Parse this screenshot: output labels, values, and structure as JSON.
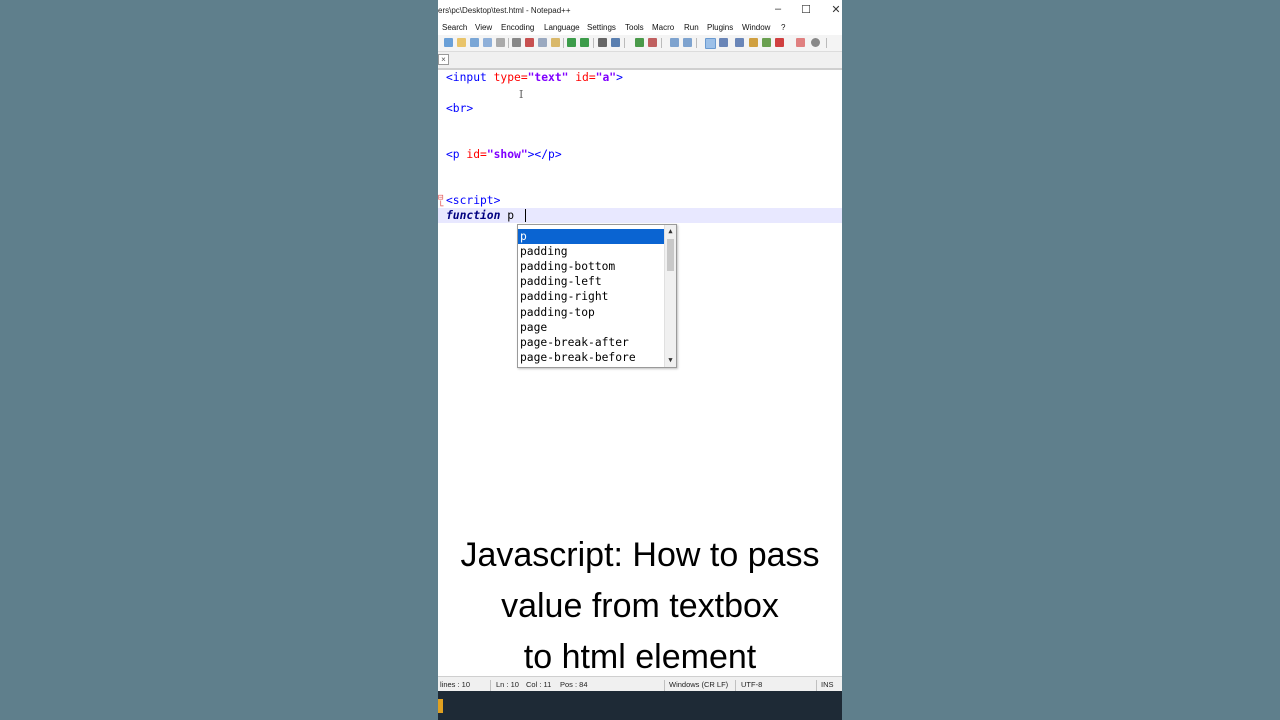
{
  "window": {
    "title": "ers\\pc\\Desktop\\test.html - Notepad++",
    "minimize": "–",
    "maximize": "☐",
    "close": "✕"
  },
  "menu": [
    "Search",
    "View",
    "Encoding",
    "Language",
    "Settings",
    "Tools",
    "Macro",
    "Run",
    "Plugins",
    "Window",
    "?"
  ],
  "editor": {
    "line1": {
      "open": "<input ",
      "attr1": "type=",
      "val1": "\"text\"",
      "attr2": " id=",
      "val2": "\"a\"",
      "close": ">"
    },
    "line3": {
      "tag": "<br>"
    },
    "line6": {
      "open": "<p ",
      "attr": "id=",
      "val": "\"show\"",
      "close": "></p>"
    },
    "line9": {
      "tag": "<script>"
    },
    "line10": {
      "keyword": "function",
      "text": " p"
    }
  },
  "autocomplete": {
    "items": [
      "p",
      "padding",
      "padding-bottom",
      "padding-left",
      "padding-right",
      "padding-top",
      "page",
      "page-break-after",
      "page-break-before"
    ],
    "selected": "p"
  },
  "caption": {
    "line1": "Javascript: How to pass",
    "line2": "value from textbox",
    "line3": "to html element"
  },
  "status": {
    "lines": "lines : 10",
    "ln": "Ln : 10",
    "col": "Col : 11",
    "pos": "Pos : 84",
    "eol": "Windows (CR LF)",
    "encoding": "UTF-8",
    "mode": "INS"
  },
  "colors": {
    "background": "#5f7f8c",
    "tag": "#0000ff",
    "attribute": "#ff0000",
    "string": "#8000ff",
    "keyword": "#000080",
    "selection": "#0a64d2"
  }
}
